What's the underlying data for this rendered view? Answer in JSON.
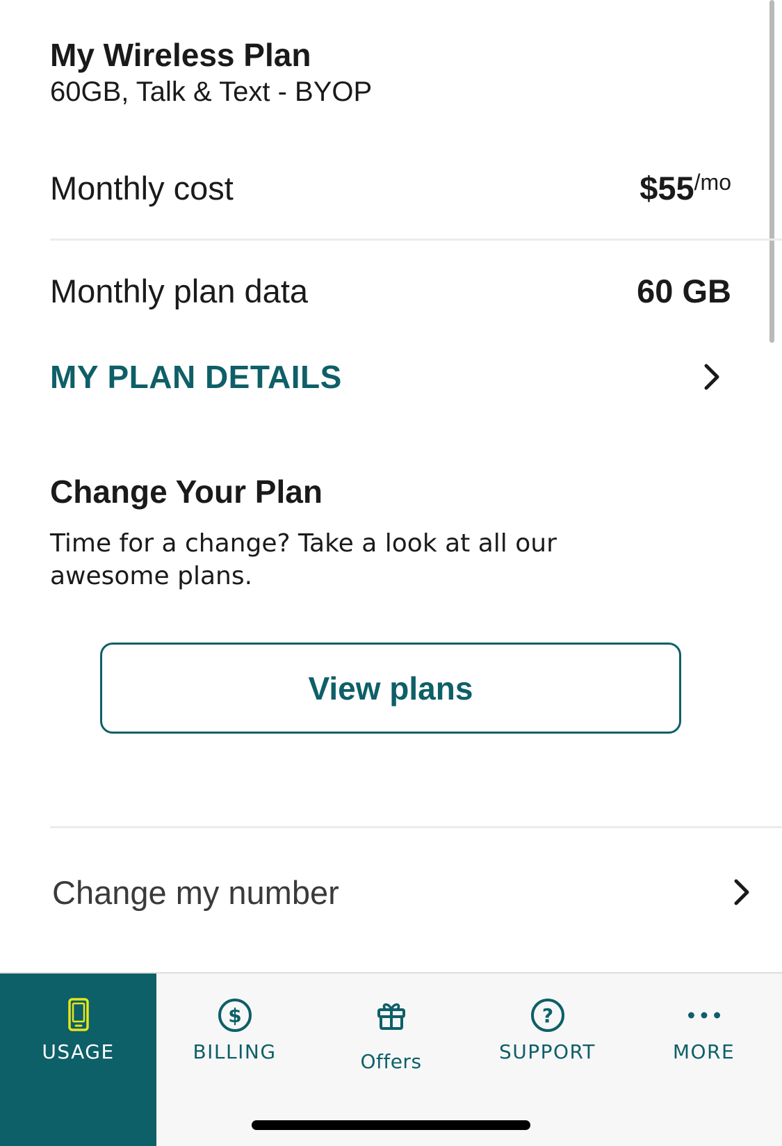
{
  "plan": {
    "title": "My Wireless Plan",
    "subtitle": "60GB, Talk & Text - BYOP"
  },
  "monthly_cost": {
    "label": "Monthly cost",
    "value": "$55",
    "unit": "/mo"
  },
  "plan_data": {
    "label": "Monthly plan data",
    "value": "60 GB"
  },
  "plan_details_link": {
    "label": "MY PLAN DETAILS",
    "icon": "chevron-right-icon"
  },
  "change_plan": {
    "title": "Change Your Plan",
    "description": "Time for a change? Take a look at all our awesome plans.",
    "button_label": "View plans"
  },
  "change_number": {
    "label": "Change my number",
    "icon": "chevron-right-icon"
  },
  "tabbar": {
    "active": "USAGE",
    "tabs": [
      {
        "label": "USAGE",
        "icon": "phone-icon"
      },
      {
        "label": "BILLING",
        "icon": "dollar-circle-icon"
      },
      {
        "label": "Offers",
        "icon": "gift-icon"
      },
      {
        "label": "SUPPORT",
        "icon": "help-circle-icon"
      },
      {
        "label": "MORE",
        "icon": "more-dots-icon"
      }
    ]
  },
  "colors": {
    "accent": "#0e5f68",
    "active_tab_bg": "#0d5f68",
    "active_icon": "#e6e619"
  }
}
